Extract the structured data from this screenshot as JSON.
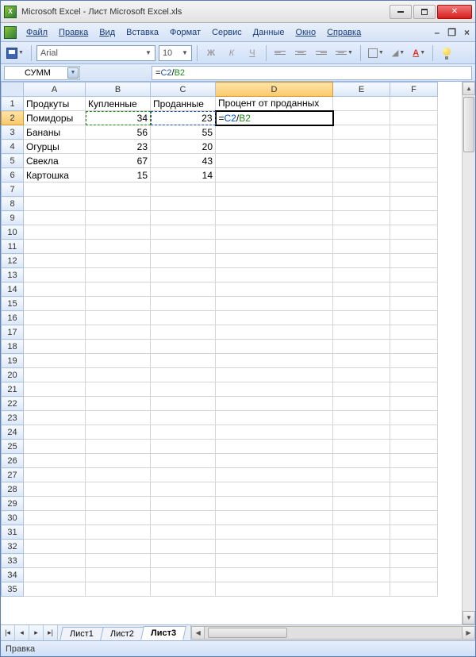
{
  "title": "Microsoft Excel - Лист Microsoft Excel.xls",
  "menu": {
    "file": "Файл",
    "edit": "Правка",
    "view": "Вид",
    "insert": "Вставка",
    "format": "Формат",
    "tools": "Сервис",
    "data": "Данные",
    "window": "Окно",
    "help": "Справка"
  },
  "toolbar": {
    "font": "Arial",
    "size": "10",
    "bold": "Ж",
    "italic": "К",
    "underline": "Ч"
  },
  "namebox": "СУММ",
  "formula": {
    "prefix": "=",
    "ref1": "C2",
    "op": "/",
    "ref2": "B2"
  },
  "columns": [
    "A",
    "B",
    "C",
    "D",
    "E",
    "F"
  ],
  "headers": {
    "a": "Продкуты",
    "b": "Купленные",
    "c": "Проданные",
    "d": "Процент от проданных"
  },
  "rows": [
    {
      "a": "Помидоры",
      "b": "34",
      "c": "23"
    },
    {
      "a": "Бананы",
      "b": "56",
      "c": "55"
    },
    {
      "a": "Огурцы",
      "b": "23",
      "c": "20"
    },
    {
      "a": "Свекла",
      "b": "67",
      "c": "43"
    },
    {
      "a": "Картошка",
      "b": "15",
      "c": "14"
    }
  ],
  "edit_cell": {
    "prefix": "=",
    "ref1": "C2",
    "op": "/",
    "ref2": "B2"
  },
  "sheets": {
    "s1": "Лист1",
    "s2": "Лист2",
    "s3": "Лист3"
  },
  "status": "Правка"
}
